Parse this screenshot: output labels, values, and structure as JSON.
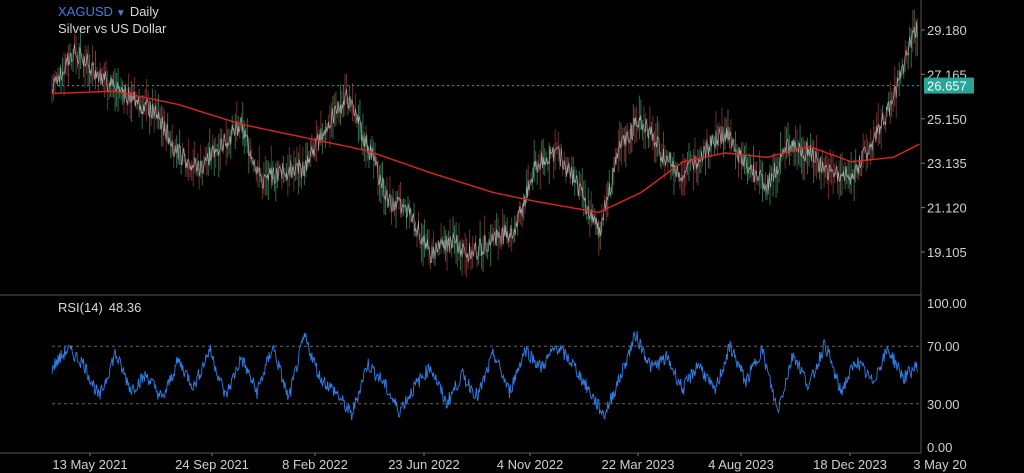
{
  "header": {
    "symbol": "XAGUSD",
    "caret_icon": "triangle-down-icon",
    "timeframe": "Daily",
    "description": "Silver vs US Dollar"
  },
  "colors": {
    "background": "#000000",
    "price_line": "#cfcfcf",
    "moving_average": "#e02424",
    "current_price_badge": "#26a69a",
    "rsi_line": "#2f7fe8",
    "symbol_text": "#3d7fe0",
    "grid_dashed": "#666666"
  },
  "chart_data": [
    {
      "type": "line",
      "title": "",
      "y_axis_position": "right",
      "ylim": [
        18.2,
        30.2
      ],
      "y_ticks": [
        "29.180",
        "27.165",
        "25.150",
        "23.135",
        "21.120",
        "19.105"
      ],
      "current_price_label": "26.657",
      "current_price": 26.657,
      "x_labels": [
        "13 May 2021",
        "24 Sep 2021",
        "8 Feb 2022",
        "23 Jun 2022",
        "4 Nov 2022",
        "22 Mar 2023",
        "4 Aug 2023",
        "18 Dec 2023",
        "3 May 20"
      ],
      "series": [
        {
          "x": [
            "2021-03-01",
            "2021-03-29",
            "2021-04-26",
            "2021-05-24",
            "2021-06-21",
            "2021-07-19",
            "2021-08-16",
            "2021-09-13",
            "2021-10-11",
            "2021-11-08",
            "2021-12-06",
            "2022-01-03",
            "2022-01-31",
            "2022-02-28",
            "2022-03-28",
            "2022-04-25",
            "2022-05-23",
            "2022-06-20",
            "2022-07-18",
            "2022-08-15",
            "2022-09-12",
            "2022-10-10",
            "2022-11-07",
            "2022-12-05",
            "2023-01-02",
            "2023-01-30",
            "2023-02-27",
            "2023-03-27",
            "2023-04-24",
            "2023-05-22",
            "2023-06-19",
            "2023-07-17",
            "2023-08-14",
            "2023-09-11",
            "2023-10-09",
            "2023-11-06",
            "2023-12-04",
            "2024-01-01",
            "2024-01-29",
            "2024-02-26",
            "2024-03-25",
            "2024-04-22"
          ],
          "values": [
            26.5,
            28.2,
            27.4,
            26.5,
            26.0,
            25.3,
            23.6,
            22.9,
            24.0,
            24.8,
            22.3,
            22.8,
            22.9,
            24.7,
            26.2,
            24.0,
            21.4,
            20.9,
            19.0,
            19.6,
            19.0,
            19.8,
            20.0,
            23.0,
            23.7,
            22.1,
            20.0,
            23.8,
            25.2,
            23.6,
            22.6,
            23.7,
            24.6,
            23.0,
            22.1,
            24.0,
            23.6,
            22.7,
            22.5,
            24.0,
            26.0,
            29.2
          ]
        },
        {
          "name": "",
          "x": [
            "2021-03-01",
            "2021-05-24",
            "2021-08-16",
            "2021-11-08",
            "2022-01-31",
            "2022-04-25",
            "2022-07-18",
            "2022-10-10",
            "2022-12-05",
            "2023-02-27",
            "2023-04-24",
            "2023-06-19",
            "2023-08-14",
            "2023-10-09",
            "2023-12-04",
            "2024-01-29",
            "2024-03-25",
            "2024-04-29"
          ],
          "values": [
            26.3,
            26.4,
            25.8,
            24.9,
            24.3,
            23.7,
            22.7,
            21.8,
            21.4,
            20.9,
            21.8,
            23.2,
            23.6,
            23.4,
            23.9,
            23.2,
            23.4,
            24.0
          ]
        }
      ]
    },
    {
      "type": "line",
      "title": "",
      "label": "RSI(14)",
      "value_label": "48.36",
      "value": 48.36,
      "ylim": [
        0,
        100
      ],
      "y_ticks": [
        "100.00",
        "70.00",
        "30.00",
        "0.00"
      ],
      "reference_lines": [
        70,
        30
      ],
      "series": [
        {
          "x": [
            "2021-03-01",
            "2021-03-22",
            "2021-04-12",
            "2021-05-03",
            "2021-05-24",
            "2021-06-14",
            "2021-07-05",
            "2021-07-26",
            "2021-08-16",
            "2021-09-06",
            "2021-09-27",
            "2021-10-18",
            "2021-11-08",
            "2021-11-29",
            "2021-12-20",
            "2022-01-10",
            "2022-01-31",
            "2022-02-21",
            "2022-03-14",
            "2022-04-04",
            "2022-04-25",
            "2022-05-16",
            "2022-06-06",
            "2022-06-27",
            "2022-07-18",
            "2022-08-08",
            "2022-08-29",
            "2022-09-19",
            "2022-10-10",
            "2022-10-31",
            "2022-11-21",
            "2022-12-12",
            "2023-01-02",
            "2023-01-23",
            "2023-02-13",
            "2023-03-06",
            "2023-03-27",
            "2023-04-17",
            "2023-05-08",
            "2023-05-29",
            "2023-06-19",
            "2023-07-10",
            "2023-07-31",
            "2023-08-21",
            "2023-09-11",
            "2023-10-02",
            "2023-10-23",
            "2023-11-13",
            "2023-12-04",
            "2023-12-25",
            "2024-01-15",
            "2024-02-05",
            "2024-02-26",
            "2024-03-18",
            "2024-04-08",
            "2024-04-29"
          ],
          "values": [
            55,
            68,
            58,
            34,
            65,
            40,
            50,
            33,
            60,
            42,
            68,
            35,
            62,
            38,
            70,
            33,
            77,
            48,
            38,
            22,
            58,
            45,
            25,
            42,
            56,
            30,
            50,
            35,
            65,
            38,
            68,
            55,
            70,
            58,
            40,
            22,
            48,
            78,
            55,
            62,
            40,
            58,
            38,
            70,
            45,
            68,
            25,
            65,
            42,
            72,
            38,
            60,
            45,
            68,
            48,
            58
          ]
        }
      ]
    }
  ]
}
